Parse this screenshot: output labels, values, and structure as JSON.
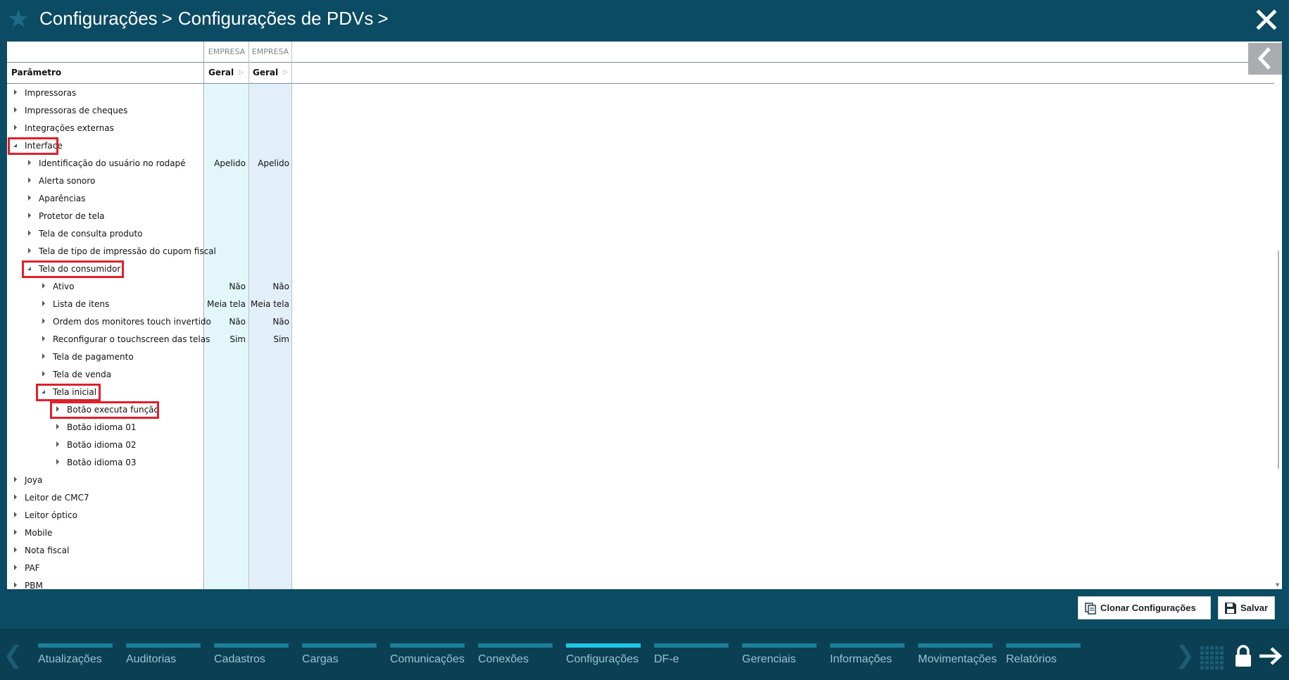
{
  "header": {
    "star_icon": "star-icon",
    "breadcrumb": [
      {
        "label": "Configurações",
        "sep": ">"
      },
      {
        "label": "Configurações de PDVs",
        "sep": ">"
      }
    ]
  },
  "grid": {
    "param_header": "Parâmetro",
    "columns": [
      {
        "group": "EMPRESA",
        "label": "Geral"
      },
      {
        "group": "EMPRESA",
        "label": "Geral"
      }
    ],
    "rows": [
      {
        "label": "Impressoras",
        "values": [
          "",
          ""
        ]
      },
      {
        "label": "Impressoras de cheques",
        "values": [
          "",
          ""
        ]
      },
      {
        "label": "Integrações externas",
        "values": [
          "",
          ""
        ]
      },
      {
        "label": "Interface",
        "values": [
          "",
          ""
        ]
      },
      {
        "label": "Identificação do usuário no rodapé",
        "values": [
          "Apelido",
          "Apelido"
        ]
      },
      {
        "label": "Alerta sonoro",
        "values": [
          "",
          ""
        ]
      },
      {
        "label": "Aparências",
        "values": [
          "",
          ""
        ]
      },
      {
        "label": "Protetor de tela",
        "values": [
          "",
          ""
        ]
      },
      {
        "label": "Tela de consulta produto",
        "values": [
          "",
          ""
        ]
      },
      {
        "label": "Tela de tipo de impressão do cupom fiscal",
        "values": [
          "",
          ""
        ]
      },
      {
        "label": "Tela do consumidor",
        "values": [
          "",
          ""
        ]
      },
      {
        "label": "Ativo",
        "values": [
          "Não",
          "Não"
        ]
      },
      {
        "label": "Lista de itens",
        "values": [
          "Meia tela",
          "Meia tela"
        ]
      },
      {
        "label": "Ordem dos monitores touch invertido",
        "values": [
          "Não",
          "Não"
        ]
      },
      {
        "label": "Reconfigurar o touchscreen das telas",
        "values": [
          "Sim",
          "Sim"
        ]
      },
      {
        "label": "Tela de pagamento",
        "values": [
          "",
          ""
        ]
      },
      {
        "label": "Tela de venda",
        "values": [
          "",
          ""
        ]
      },
      {
        "label": "Tela inicial",
        "values": [
          "",
          ""
        ]
      },
      {
        "label": "Botão executa função",
        "values": [
          "",
          ""
        ]
      },
      {
        "label": "Botão idioma 01",
        "values": [
          "",
          ""
        ]
      },
      {
        "label": "Botão idioma 02",
        "values": [
          "",
          ""
        ]
      },
      {
        "label": "Botão idioma 03",
        "values": [
          "",
          ""
        ]
      },
      {
        "label": "Joya",
        "values": [
          "",
          ""
        ]
      },
      {
        "label": "Leitor de CMC7",
        "values": [
          "",
          ""
        ]
      },
      {
        "label": "Leitor óptico",
        "values": [
          "",
          ""
        ]
      },
      {
        "label": "Mobile",
        "values": [
          "",
          ""
        ]
      },
      {
        "label": "Nota fiscal",
        "values": [
          "",
          ""
        ]
      },
      {
        "label": "PAF",
        "values": [
          "",
          ""
        ]
      },
      {
        "label": "PBM",
        "values": [
          "",
          ""
        ]
      }
    ]
  },
  "actions": {
    "clone_label": "Clonar Configurações",
    "save_label": "Salvar"
  },
  "nav": {
    "items": [
      {
        "label": "Atualizações"
      },
      {
        "label": "Auditorias"
      },
      {
        "label": "Cadastros"
      },
      {
        "label": "Cargas"
      },
      {
        "label": "Comunicações"
      },
      {
        "label": "Conexões"
      },
      {
        "label": "Configurações",
        "active": true
      },
      {
        "label": "DF-e"
      },
      {
        "label": "Gerenciais"
      },
      {
        "label": "Informações"
      },
      {
        "label": "Movimentações"
      },
      {
        "label": "Relatórios"
      }
    ]
  },
  "colors": {
    "header_bg": "#0b4b63",
    "nav_bg": "#0a3f54",
    "nav_active": "#1ec8e6",
    "nav_bar": "#1b7f98",
    "highlight_box": "#e0202a"
  }
}
